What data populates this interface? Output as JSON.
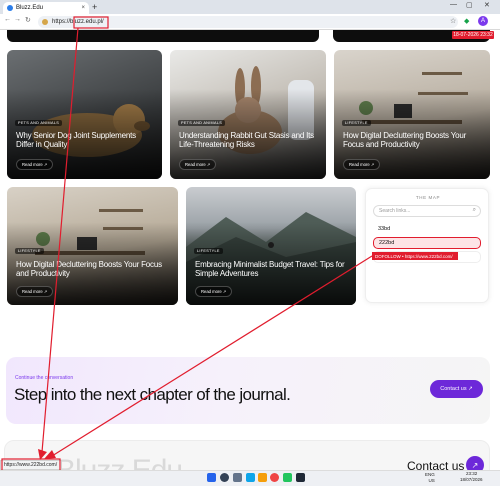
{
  "browser": {
    "tab_title": "Bluzz.Edu",
    "tab_close": "×",
    "new_tab": "+",
    "url": "https://bluzz.edu.pl/",
    "status_url": "https://www.222bd.com/",
    "win_controls": [
      "—",
      "▢",
      "✕"
    ]
  },
  "page": {
    "top_timestamp": "18-07-2026 23:32",
    "cards": [
      {
        "category": "PETS AND ANIMALS",
        "title": "Why Senior Dog Joint Supplements Differ in Quality",
        "read_more": "Read more ↗"
      },
      {
        "category": "PETS AND ANIMALS",
        "title": "Understanding Rabbit Gut Stasis and Its Life-Threatening Risks",
        "read_more": "Read more ↗"
      },
      {
        "category": "LIFESTYLE",
        "title": "How Digital Decluttering Boosts Your Focus and Productivity",
        "read_more": "Read more ↗"
      },
      {
        "category": "LIFESTYLE",
        "title": "How Digital Decluttering Boosts Your Focus and Productivity",
        "read_more": "Read more ↗"
      },
      {
        "category": "LIFESTYLE",
        "title": "Embracing Minimalist Budget Travel: Tips for Simple Adventures",
        "read_more": "Read more ↗"
      }
    ],
    "map": {
      "title": "THE MAP",
      "search_placeholder": "Search links...",
      "links": [
        "33bd",
        "222bd"
      ],
      "tooltip": "DOFOLLOW • https://www.222bd.com/"
    },
    "cta": {
      "eyebrow": "Continue the conversation",
      "heading": "Step into the next chapter of the journal.",
      "button": "Contact us ↗"
    },
    "footer": {
      "brand": "Bluzz.Edu",
      "contact": "Contact us",
      "arrow": "↗"
    }
  },
  "taskbar": {
    "tray_lang": "ENG\nUS",
    "time": "23:32",
    "date": "18/07/2026"
  },
  "colors": {
    "accent": "#6d28d9",
    "annotation_red": "#e11d2e"
  }
}
